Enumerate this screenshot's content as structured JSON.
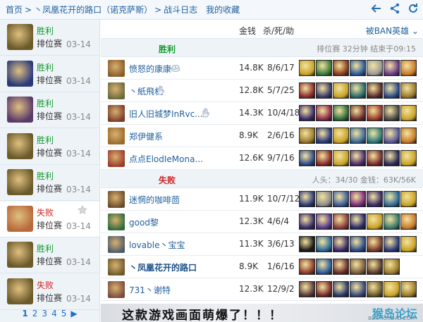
{
  "nav": {
    "home": "首页",
    "sep": ">",
    "summoner": "丶凤凰花开的路口（诺克萨斯）",
    "battle_log": "战斗日志",
    "favorites": "我的收藏"
  },
  "top_icons": [
    "back-arrow-icon",
    "share-icon",
    "refresh-icon"
  ],
  "sidebar": {
    "matches": [
      {
        "result": "胜利",
        "outcome": "win",
        "mode": "排位赛",
        "date": "03-14",
        "portrait_color": "#6b5a2a"
      },
      {
        "result": "胜利",
        "outcome": "win",
        "mode": "排位赛",
        "date": "03-14",
        "portrait_color": "#2a3a7a"
      },
      {
        "result": "胜利",
        "outcome": "win",
        "mode": "排位赛",
        "date": "03-14",
        "portrait_color": "#5a3a6a"
      },
      {
        "result": "胜利",
        "outcome": "win",
        "mode": "排位赛",
        "date": "03-14",
        "portrait_color": "#6b5a2a"
      },
      {
        "result": "胜利",
        "outcome": "win",
        "mode": "排位赛",
        "date": "03-14",
        "portrait_color": "#6b5a2a"
      },
      {
        "result": "失败",
        "outcome": "lose",
        "mode": "排位赛",
        "date": "03-14",
        "portrait_color": "#b86a3a",
        "selected": true
      },
      {
        "result": "胜利",
        "outcome": "win",
        "mode": "排位赛",
        "date": "03-14",
        "portrait_color": "#6b5a2a"
      },
      {
        "result": "失败",
        "outcome": "lose",
        "mode": "排位赛",
        "date": "03-14",
        "portrait_color": "#6b5a2a"
      }
    ],
    "pager": [
      "1",
      "2",
      "3",
      "4",
      "5"
    ],
    "pager_next": "▶"
  },
  "header": {
    "money": "金钱",
    "kda": "杀/死/助",
    "banned": "被BAN英雄 ⌄"
  },
  "teams": [
    {
      "result": "胜利",
      "outcome": "win",
      "info": "排位赛 32分钟 结束于09:15",
      "players": [
        {
          "name": "愤怒的康康",
          "tag": "cloud",
          "money": "14.8K",
          "kda": "8/6/17",
          "color": "#8a5a2a",
          "items": [
            "#c9a227",
            "#3a7a3a",
            "#8a3a1a",
            "#2a5a9a",
            "#9a9a9a",
            "#6a3a8a",
            "#c97a2a"
          ]
        },
        {
          "name": "丶紙飛机",
          "tag": "hand",
          "money": "12.8K",
          "kda": "5/7/25",
          "color": "#6a6a3a",
          "items": [
            "#8a2a2a",
            "#3a3a6a",
            "#c9a227",
            "#2a6a6a",
            "#5a2a2a",
            "#2a4a8a",
            "#9a7a2a"
          ]
        },
        {
          "name": "旧人旧城梦InRvc...",
          "tag": "hand",
          "money": "14.3K",
          "kda": "10/4/18",
          "color": "#7a3a2a",
          "items": [
            "#3a2a6a",
            "#8a2a4a",
            "#2a6a3a",
            "#6a2a2a",
            "#9a3a2a",
            "#4a4a4a",
            "#c9a227"
          ]
        },
        {
          "name": "郑伊健系",
          "tag": "",
          "money": "8.9K",
          "kda": "2/6/16",
          "color": "#9a6a2a",
          "items": [
            "#9a7a2a",
            "#2a3a7a",
            "#c9a227",
            "#3a6a9a",
            "#2a7a7a",
            "#5a5a9a",
            "#c97a2a"
          ]
        },
        {
          "name": "点点ElodIeMona...",
          "tag": "",
          "money": "12.6K",
          "kda": "9/7/16",
          "color": "#9a3a2a",
          "items": [
            "#2a4a8a",
            "#8a2a2a",
            "#c9a227",
            "#4a2a6a",
            "#7a2a2a",
            "#2a2a5a",
            "#c9a227"
          ]
        }
      ]
    },
    {
      "result": "失败",
      "outcome": "lose",
      "info": "人头：34/30 金钱：63K/56K",
      "players": [
        {
          "name": "迷惘的咖啡茴",
          "tag": "",
          "money": "11.9K",
          "kda": "10/7/12",
          "color": "#6a4a2a",
          "items": [
            "#2a3a7a",
            "#8a8a8a",
            "#3a5a9a",
            "#7a2a7a",
            "#3a2a6a",
            "#2a6a9a",
            "#c9a227"
          ]
        },
        {
          "name": "good黎",
          "tag": "",
          "money": "12.3K",
          "kda": "4/6/4",
          "color": "#2a6a3a",
          "items": [
            "#3a2a6a",
            "#5a3a8a",
            "#8a3a3a",
            "#2a2a6a",
            "#c9a227",
            "#3a7a6a",
            "#c97a2a"
          ]
        },
        {
          "name": "lovable丶宝宝",
          "tag": "",
          "money": "11.3K",
          "kda": "3/6/13",
          "color": "#4a5a6a",
          "items": [
            "#1a1a1a",
            "#2a6a9a",
            "#3a2a6a",
            "#2a4a8a",
            "#7a3a2a",
            "#2a3a7a",
            "#c9a227"
          ]
        },
        {
          "name": "丶凤凰花开的路口",
          "tag": "",
          "me": true,
          "money": "8.9K",
          "kda": "1/6/16",
          "color": "#6b5a2a",
          "items": [
            "#8a3a2a",
            "#2a5a9a",
            "#6a2a2a",
            "#7a5a3a",
            "#5a3a2a",
            "#9a7a2a"
          ]
        },
        {
          "name": "731丶谢特",
          "tag": "",
          "money": "12.3K",
          "kda": "12/9/2",
          "color": "#7a4a3a",
          "items": [
            "#5a3a3a",
            "#7a2a2a",
            "#2a3a6a",
            "#3a4a7a",
            "#6a5a2a",
            "#c9a227",
            "#9a7a2a"
          ]
        }
      ]
    }
  ],
  "banner": {
    "text": "这款游戏画面萌爆了！！！",
    "watermark": "猴岛论坛",
    "watermark_sub": "BBS.HOUDAO.COM"
  }
}
